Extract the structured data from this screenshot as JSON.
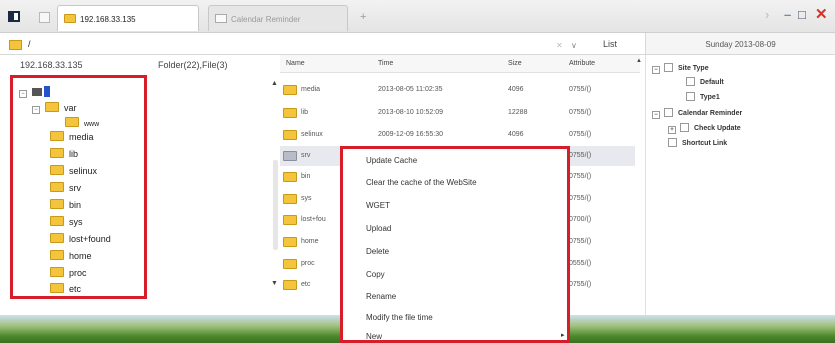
{
  "tabs": [
    {
      "label": "192.168.33.135",
      "active": true
    },
    {
      "label": "Calendar Reminder",
      "active": false
    }
  ],
  "tab_add": "+",
  "window_controls": {
    "back": "›",
    "minimize": "–",
    "maximize": "□",
    "close": "✕"
  },
  "address": {
    "path": "/",
    "clear": "✕",
    "dropdown": "∨",
    "view_mode": "List"
  },
  "date_header": "Sunday 2013-08-09",
  "tree_pane": {
    "ip": "192.168.33.135",
    "count": "Folder(22),File(3)",
    "nodes": [
      "var",
      "www",
      "media",
      "lib",
      "selinux",
      "srv",
      "bin",
      "sys",
      "lost+found",
      "home",
      "proc",
      "etc"
    ]
  },
  "file_list": {
    "headers": [
      "Name",
      "Time",
      "Size",
      "Attribute"
    ],
    "rows": [
      {
        "name": "media",
        "time": "2013-08-05 11:02:35",
        "size": "4096",
        "attr": "0755/()"
      },
      {
        "name": "lib",
        "time": "2013-08-10 10:52:09",
        "size": "12288",
        "attr": "0755/()"
      },
      {
        "name": "selinux",
        "time": "2009-12-09 16:55:30",
        "size": "4096",
        "attr": "0755/()"
      },
      {
        "name": "srv",
        "time": "",
        "size": "",
        "attr": "0755/()"
      },
      {
        "name": "bin",
        "time": "",
        "size": "",
        "attr": "0755/()"
      },
      {
        "name": "sys",
        "time": "",
        "size": "",
        "attr": "0755/()"
      },
      {
        "name": "lost+fou",
        "time": "",
        "size": "",
        "attr": "0700/()"
      },
      {
        "name": "home",
        "time": "",
        "size": "",
        "attr": "0755/()"
      },
      {
        "name": "proc",
        "time": "",
        "size": "",
        "attr": "0555/()"
      },
      {
        "name": "etc",
        "time": "",
        "size": "",
        "attr": "0755/()"
      }
    ]
  },
  "context_menu": {
    "items": [
      "Update Cache",
      "Clear the cache of the WebSite",
      "WGET",
      "Upload",
      "Delete",
      "Copy",
      "Rename",
      "Modify the file time",
      "New"
    ],
    "submenu_arrow": "▸"
  },
  "right_pane": {
    "site_type": "Site Type",
    "default": "Default",
    "type1": "Type1",
    "calendar_reminder": "Calendar Reminder",
    "check_update": "Check Update",
    "shortcut_link": "Shortcut Link"
  },
  "colors": {
    "highlight_border": "#d71d2a",
    "folder": "#f3c43c",
    "selection": "#2255cc"
  }
}
